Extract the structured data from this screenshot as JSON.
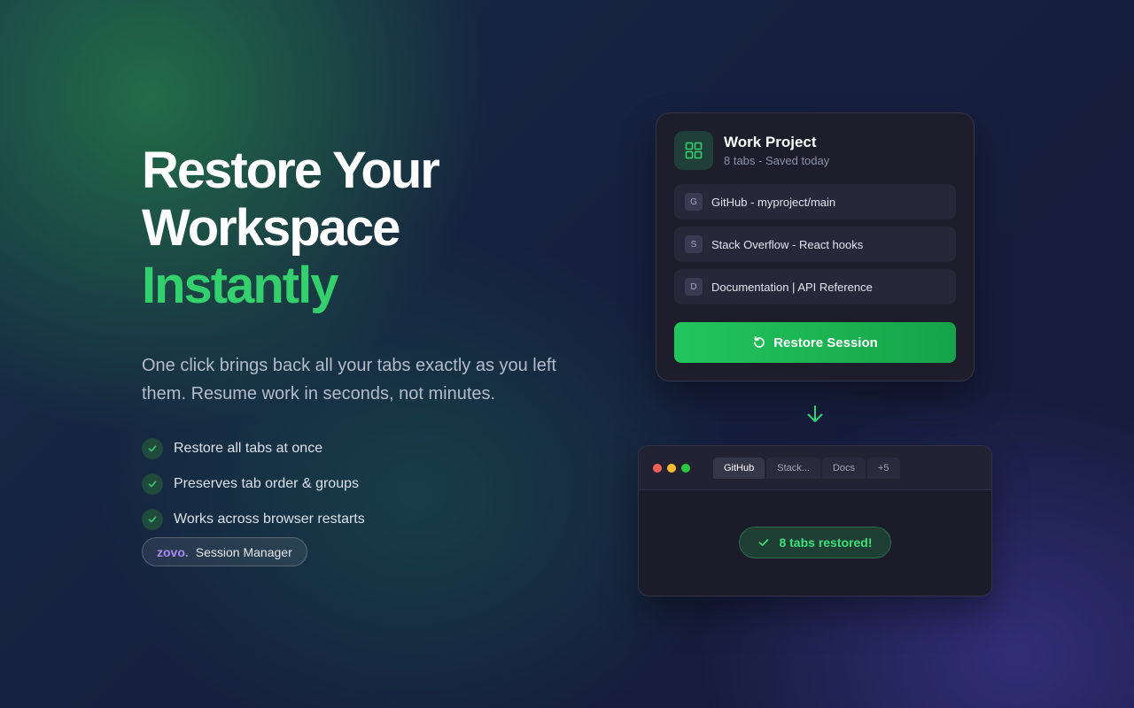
{
  "hero": {
    "headline_line1": "Restore Your",
    "headline_line2": "Workspace",
    "headline_accent": "Instantly",
    "subtitle": "One click brings back all your tabs exactly as you left them. Resume work in seconds, not minutes.",
    "features": [
      "Restore all tabs at once",
      "Preserves tab order & groups",
      "Works across browser restarts"
    ],
    "badge": {
      "brand": "zovo.",
      "product": "Session Manager"
    }
  },
  "session_card": {
    "icon": "grid-icon",
    "title": "Work Project",
    "meta": "8 tabs - Saved today",
    "tabs": [
      {
        "favicon": "G",
        "label": "GitHub - myproject/main"
      },
      {
        "favicon": "S",
        "label": "Stack Overflow - React hooks"
      },
      {
        "favicon": "D",
        "label": "Documentation | API Reference"
      }
    ],
    "restore_label": "Restore Session"
  },
  "browser": {
    "tabs": [
      "GitHub",
      "Stack...",
      "Docs",
      "+5"
    ],
    "active_tab": "GitHub",
    "toast": "8 tabs restored!"
  },
  "colors": {
    "accent": "#34d06e",
    "button": "#22c55e",
    "brand": "#a88bf5",
    "card_bg": "#1d1d2b"
  }
}
